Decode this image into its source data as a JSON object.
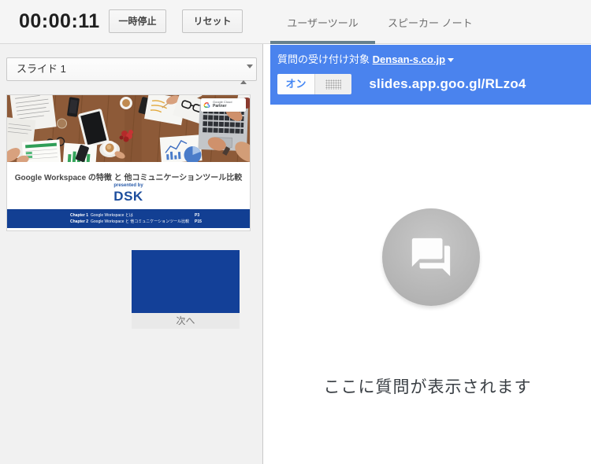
{
  "timer": {
    "value": "00:00:11",
    "pause_label": "一時停止",
    "reset_label": "リセット"
  },
  "slide_selector": {
    "value": "スライド 1"
  },
  "slide_preview": {
    "badge": {
      "line1": "Google Cloud",
      "line2": "Partner"
    },
    "title": "Google Workspace の特徴 と 他コミュニケーションツール比較",
    "presented_by": "presented by",
    "logo": "DSK",
    "chapters": [
      {
        "chapter": "Chapter 1",
        "title": "Google Workspace とは",
        "page": "P3"
      },
      {
        "chapter": "Chapter 2",
        "title": "Google Workspace と 他コミュニケーションツール比較",
        "page": "P15"
      }
    ]
  },
  "next": {
    "label": "次へ"
  },
  "tabs": [
    {
      "label": "ユーザーツール",
      "active": true
    },
    {
      "label": "スピーカー ノート",
      "active": false
    }
  ],
  "qa": {
    "audience_label": "質問の受け付け対象",
    "audience_value": "Densan-s.co.jp",
    "toggle_on": "オン",
    "url": "slides.app.goo.gl/RLzo4",
    "empty_message": "ここに質問が表示されます"
  },
  "colors": {
    "header_blue": "#4a83ee",
    "toggle_text_blue": "#4285f4",
    "slide_navy": "#123f93",
    "tab_underline": "#65808d",
    "left_panel_bg": "#f1f1f1"
  }
}
